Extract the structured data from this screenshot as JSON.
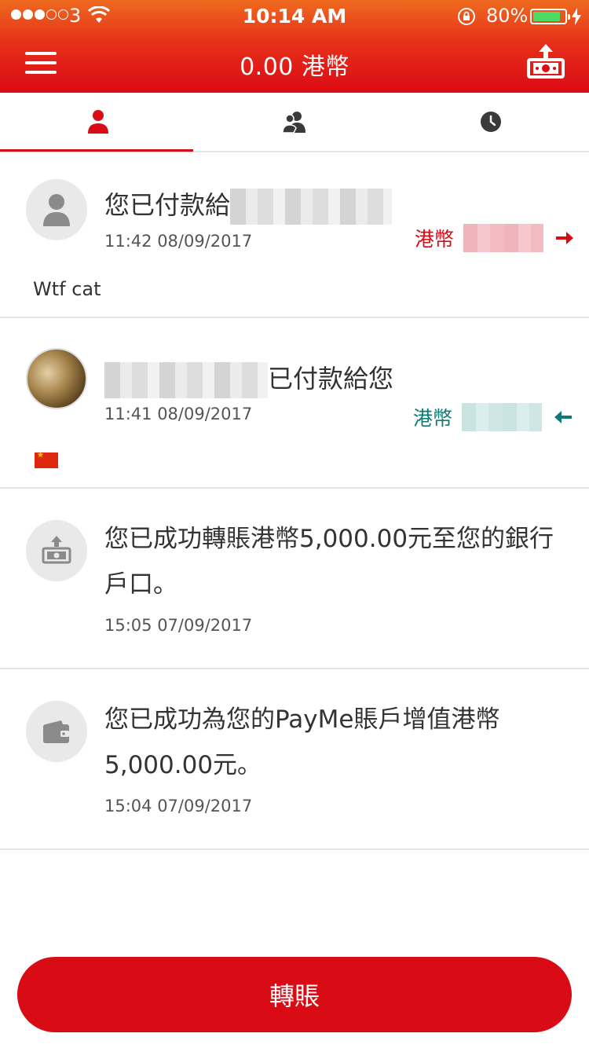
{
  "status_bar": {
    "carrier": "3",
    "time": "10:14 AM",
    "battery": "80%"
  },
  "nav": {
    "balance": "0.00 港幣"
  },
  "tabs": [
    {
      "name": "personal",
      "icon": "person-icon",
      "active": true
    },
    {
      "name": "friends",
      "icon": "group-icon",
      "active": false
    },
    {
      "name": "history",
      "icon": "clock-icon",
      "active": false
    }
  ],
  "feed": [
    {
      "title": "您已付款給",
      "time": "11:42 08/09/2017",
      "currency": "港幣",
      "direction": "out",
      "note": "Wtf cat",
      "color": "#d90b15"
    },
    {
      "title": "已付款給您",
      "time": "11:41 08/09/2017",
      "currency": "港幣",
      "direction": "in",
      "color": "#0c7b77"
    },
    {
      "message": "您已成功轉賬港幣5,000.00元至您的銀行戶口。",
      "time": "15:05 07/09/2017",
      "icon": "bank-transfer-icon"
    },
    {
      "message": "您已成功為您的PayMe賬戶增值港幣5,000.00元。",
      "time": "15:04 07/09/2017",
      "icon": "wallet-icon"
    }
  ],
  "transfer_button": "轉賬",
  "colors": {
    "brand": "#d90b15",
    "incoming": "#0c7b77"
  }
}
